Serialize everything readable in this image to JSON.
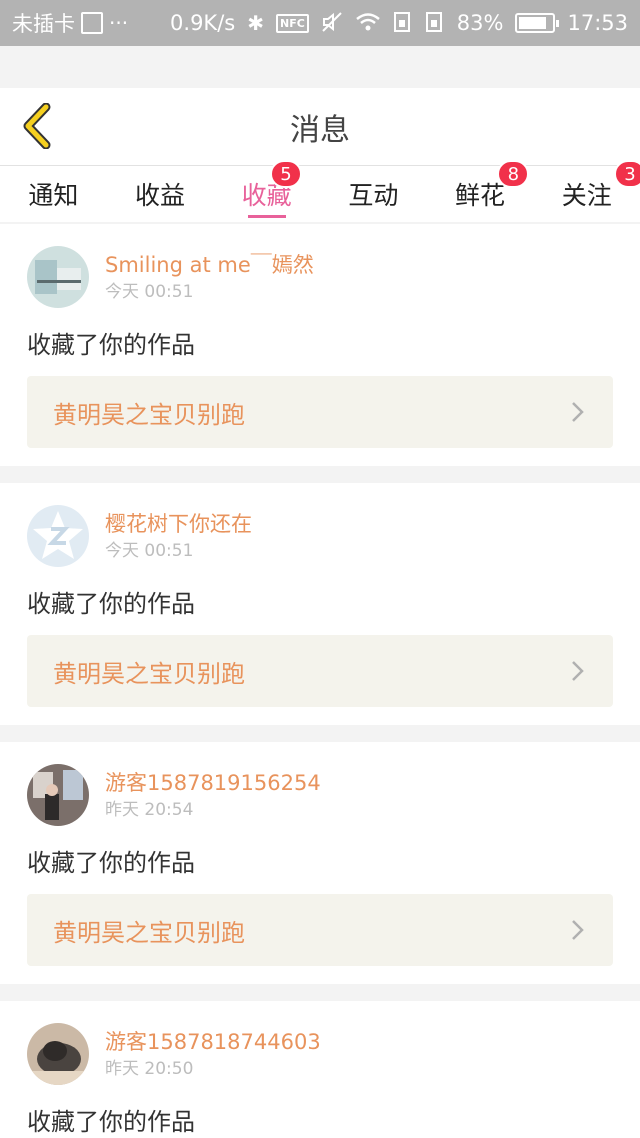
{
  "status_bar": {
    "carrier": "未插卡",
    "net_speed": "0.9K/s",
    "nfc": "NFC",
    "battery": "83%",
    "battery_level": 0.83,
    "time": "17:53"
  },
  "header": {
    "title": "消息"
  },
  "tabs": [
    {
      "label": "通知",
      "badge": ""
    },
    {
      "label": "收益",
      "badge": ""
    },
    {
      "label": "收藏",
      "badge": "5",
      "active": true
    },
    {
      "label": "互动",
      "badge": ""
    },
    {
      "label": "鲜花",
      "badge": "8"
    },
    {
      "label": "关注",
      "badge": "3"
    }
  ],
  "feed": [
    {
      "username": "Smiling at me￣嫣然",
      "time": "今天 00:51",
      "action": "收藏了你的作品",
      "work": "黄明昊之宝贝别跑"
    },
    {
      "username": "樱花树下你还在",
      "time": "今天 00:51",
      "action": "收藏了你的作品",
      "work": "黄明昊之宝贝别跑"
    },
    {
      "username": "游客1587819156254",
      "time": "昨天 20:54",
      "action": "收藏了你的作品",
      "work": "黄明昊之宝贝别跑"
    },
    {
      "username": "游客1587818744603",
      "time": "昨天 20:50",
      "action": "收藏了你的作品",
      "work": ""
    }
  ],
  "colors": {
    "accent_pink": "#e8619a",
    "username_orange": "#e8935c",
    "badge_red": "#f1314a",
    "back_yellow": "#f5d020"
  },
  "icons": {
    "back": "back-arrow-icon",
    "chevron": "chevron-right-icon"
  }
}
